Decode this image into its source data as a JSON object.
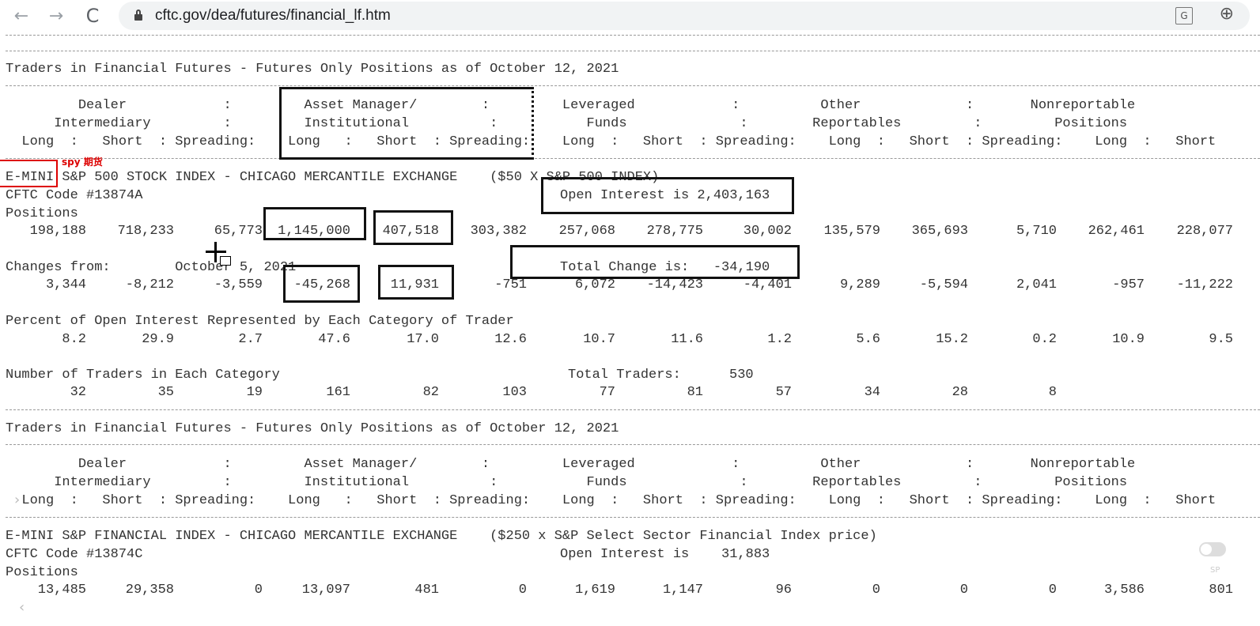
{
  "browser": {
    "url": "cftc.gov/dea/futures/financial_lf.htm",
    "nav_back": "←",
    "nav_forward": "→",
    "nav_reload": "C",
    "translate_icon": "G",
    "zoom_icon": "⊕"
  },
  "report": {
    "title_1": "Traders in Financial Futures - Futures Only Positions as of October 12, 2021",
    "header_line_1": "         Dealer            :         Asset Manager/        :         Leveraged            :          Other             :       Nonreportable",
    "header_line_2": "      Intermediary         :         Institutional          :           Funds              :        Reportables         :         Positions",
    "header_line_3": "  Long  :   Short  : Spreading:    Long   :   Short  : Spreading:    Long  :   Short  : Spreading:    Long  :   Short  : Spreading:    Long  :   Short",
    "contract_1": {
      "name": "E-MINI S&P 500 STOCK INDEX - CHICAGO MERCANTILE EXCHANGE    ($50 X S&P 500 INDEX)",
      "code": "CFTC Code #13874A",
      "open_interest": "Open Interest is 2,403,163",
      "positions_label": "Positions",
      "positions": [
        "198,188",
        "718,233",
        "65,773",
        "1,145,000",
        "407,518",
        "303,382",
        "257,068",
        "278,775",
        "30,002",
        "135,579",
        "365,693",
        "5,710",
        "262,461",
        "228,077"
      ],
      "changes_label": "Changes from:        October 5, 2021",
      "total_change": "Total Change is:   -34,190",
      "changes": [
        "3,344",
        "-8,212",
        "-3,559",
        "-45,268",
        "11,931",
        "-751",
        "6,072",
        "-14,423",
        "-4,401",
        "9,289",
        "-5,594",
        "2,041",
        "-957",
        "-11,222"
      ],
      "percent_label": "Percent of Open Interest Represented by Each Category of Trader",
      "percent": [
        "8.2",
        "29.9",
        "2.7",
        "47.6",
        "17.0",
        "12.6",
        "10.7",
        "11.6",
        "1.2",
        "5.6",
        "15.2",
        "0.2",
        "10.9",
        "9.5"
      ],
      "traders_label": "Number of Traders in Each Category",
      "total_traders": "Total Traders:      530",
      "traders": [
        "32",
        "35",
        "19",
        "161",
        "82",
        "103",
        "77",
        "81",
        "57",
        "34",
        "28",
        "8"
      ]
    },
    "title_2": "Traders in Financial Futures - Futures Only Positions as of October 12, 2021",
    "contract_2": {
      "name": "E-MINI S&P FINANCIAL INDEX - CHICAGO MERCANTILE EXCHANGE    ($250 x S&P Select Sector Financial Index price)",
      "code": "CFTC Code #13874C",
      "open_interest": "Open Interest is    31,883",
      "positions_label": "Positions",
      "positions": [
        "13,485",
        "29,358",
        "0",
        "13,097",
        "481",
        "0",
        "1,619",
        "1,147",
        "96",
        "0",
        "0",
        "0",
        "3,586",
        "801"
      ]
    }
  },
  "annotation": {
    "label": "spy 期货"
  },
  "overlay": {
    "chevron_right": "›",
    "chevron_left": "‹",
    "side_label": "SP"
  }
}
